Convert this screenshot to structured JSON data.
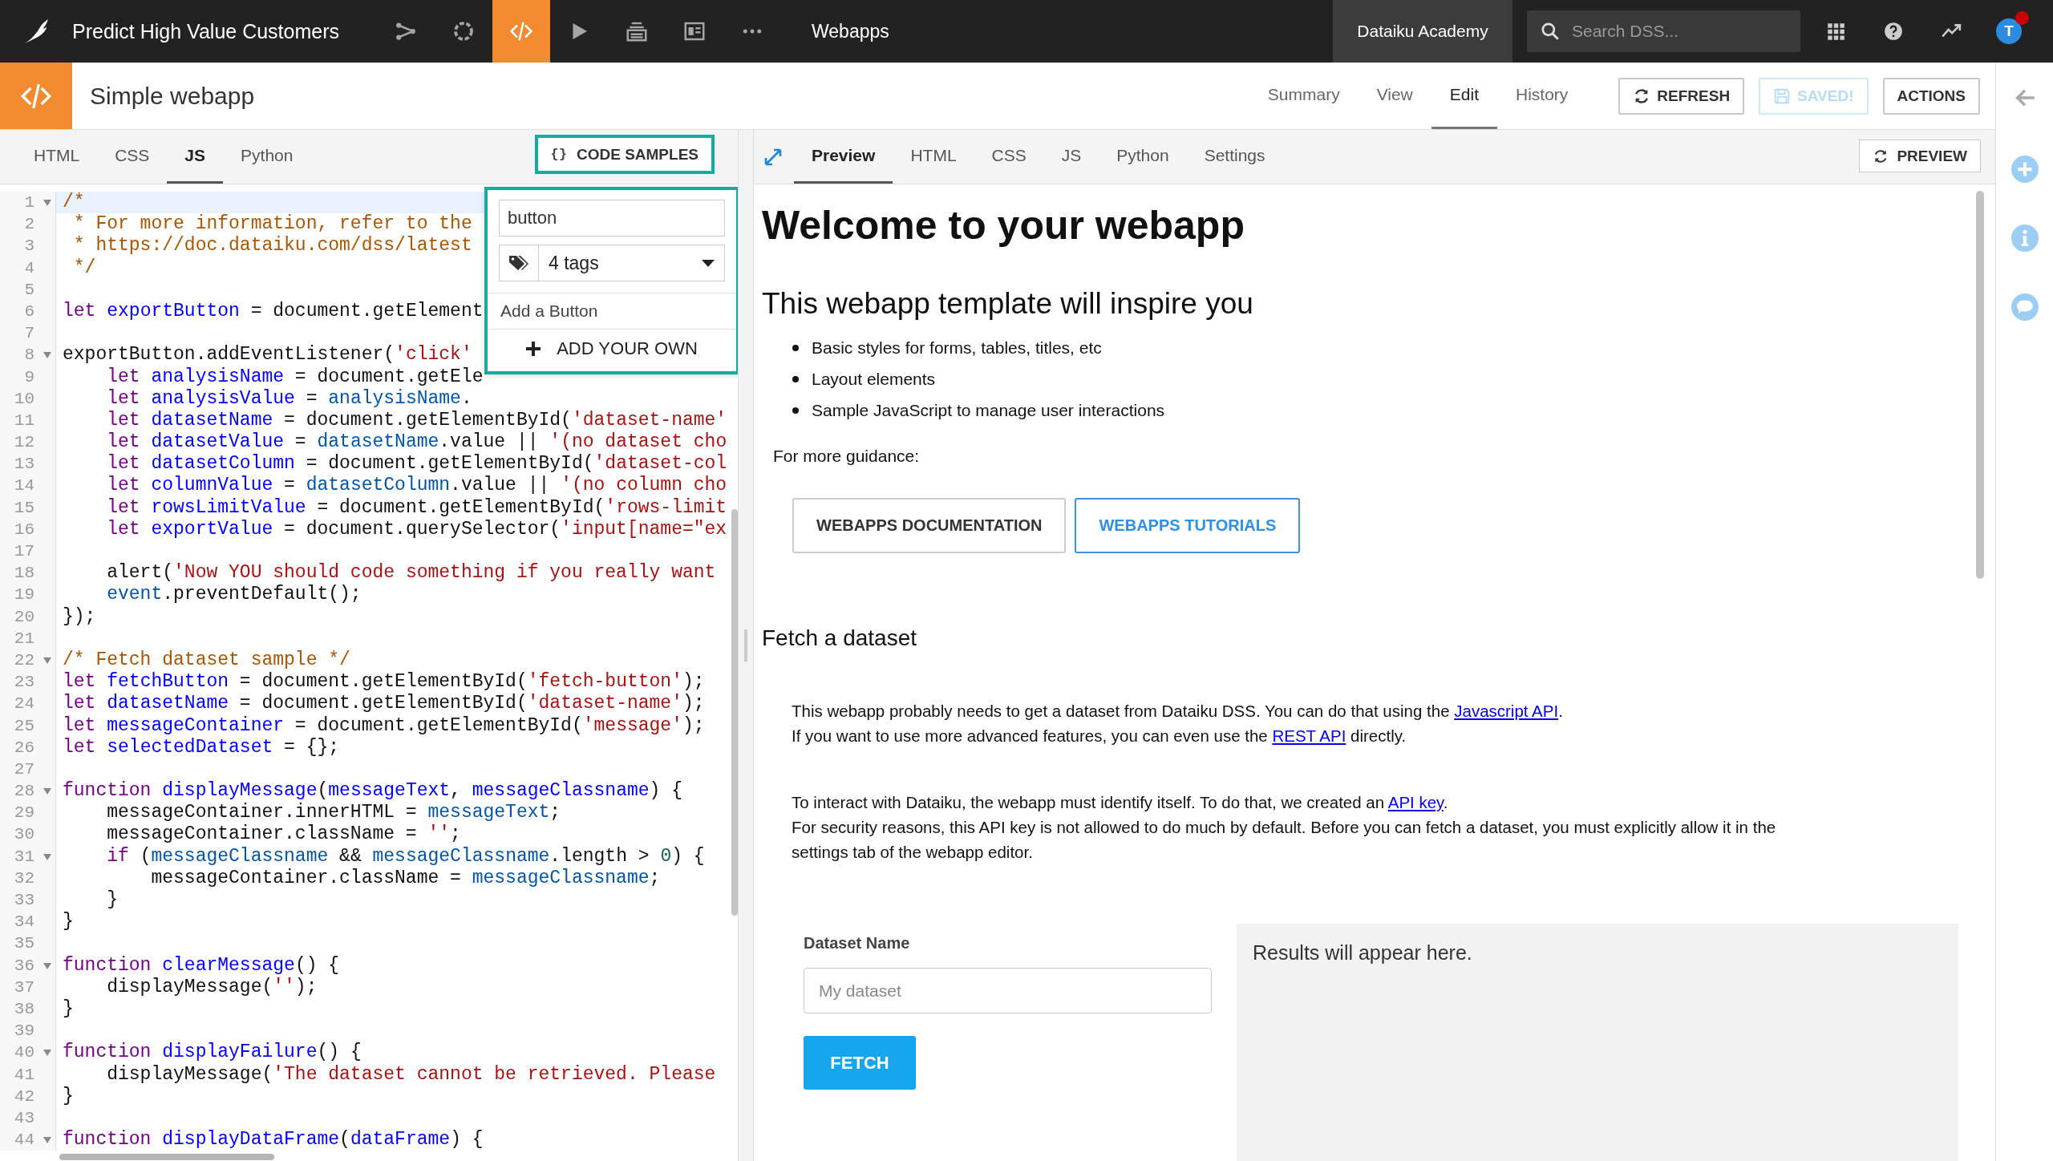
{
  "top_bar": {
    "project_title": "Predict High Value Customers",
    "nav_icons": [
      {
        "kind": "flow",
        "selected": false
      },
      {
        "kind": "lab",
        "selected": false
      },
      {
        "kind": "code",
        "selected": true
      },
      {
        "kind": "run",
        "selected": false
      },
      {
        "kind": "deploy",
        "selected": false
      },
      {
        "kind": "dashboard",
        "selected": false
      },
      {
        "kind": "more",
        "selected": false
      }
    ],
    "section": "Webapps",
    "workspace": "Dataiku Academy",
    "search": {
      "placeholder": "Search DSS..."
    },
    "tools": [
      {
        "kind": "apps"
      },
      {
        "kind": "help"
      },
      {
        "kind": "trend"
      }
    ],
    "avatar": {
      "initial": "T",
      "notification": true
    }
  },
  "header": {
    "title": "Simple webapp",
    "tabs": [
      {
        "label": "Summary",
        "selected": false
      },
      {
        "label": "View",
        "selected": false
      },
      {
        "label": "Edit",
        "selected": true
      },
      {
        "label": "History",
        "selected": false
      }
    ],
    "buttons": [
      {
        "label": "REFRESH",
        "kind": "refresh",
        "disabled": false
      },
      {
        "label": "SAVED!",
        "kind": "save",
        "disabled": true
      },
      {
        "label": "ACTIONS",
        "kind": "plain",
        "disabled": false
      }
    ]
  },
  "editor": {
    "tabs": [
      {
        "label": "HTML",
        "selected": false
      },
      {
        "label": "CSS",
        "selected": false
      },
      {
        "label": "JS",
        "selected": true
      },
      {
        "label": "Python",
        "selected": false
      }
    ],
    "code_samples_button": {
      "glyph": "{}",
      "label": "CODE SAMPLES",
      "highlighted": true
    },
    "code_samples_dropdown": {
      "highlighted": true,
      "search_value": "button",
      "tags_filter": "4 tags",
      "items": [
        "Add a Button"
      ],
      "add_own": "ADD YOUR OWN"
    },
    "lines": [
      {
        "n": "1",
        "fold": true,
        "active": true,
        "tokens": [
          {
            "kind": "com",
            "text": "/*"
          }
        ]
      },
      {
        "n": "2",
        "fold": false,
        "active": false,
        "tokens": [
          {
            "kind": "com",
            "text": " * For more information, refer to the"
          }
        ]
      },
      {
        "n": "3",
        "fold": false,
        "active": false,
        "tokens": [
          {
            "kind": "com",
            "text": " * https://doc.dataiku.com/dss/latest"
          }
        ]
      },
      {
        "n": "4",
        "fold": false,
        "active": false,
        "tokens": [
          {
            "kind": "com",
            "text": " */"
          }
        ]
      },
      {
        "n": "5",
        "fold": false,
        "active": false
      },
      {
        "n": "6",
        "fold": false,
        "active": false,
        "tokens": [
          {
            "kind": "kw",
            "text": "let "
          },
          {
            "kind": "def",
            "text": "exportButton"
          },
          {
            "kind": "p",
            "text": " = document.getElement"
          }
        ]
      },
      {
        "n": "7",
        "fold": false,
        "active": false
      },
      {
        "n": "8",
        "fold": true,
        "active": false,
        "tokens": [
          {
            "kind": "p",
            "text": "exportButton.addEventListener("
          },
          {
            "kind": "str",
            "text": "'click'"
          }
        ]
      },
      {
        "n": "9",
        "fold": false,
        "active": false,
        "tokens": [
          {
            "kind": "kw",
            "text": "    let "
          },
          {
            "kind": "def",
            "text": "analysisName"
          },
          {
            "kind": "p",
            "text": " = document.getEle"
          }
        ]
      },
      {
        "n": "10",
        "fold": false,
        "active": false,
        "tokens": [
          {
            "kind": "kw",
            "text": "    let "
          },
          {
            "kind": "def",
            "text": "analysisValue"
          },
          {
            "kind": "p",
            "text": " = "
          },
          {
            "kind": "var",
            "text": "analysisName"
          },
          {
            "kind": "p",
            "text": "."
          }
        ]
      },
      {
        "n": "11",
        "fold": false,
        "active": false,
        "tokens": [
          {
            "kind": "kw",
            "text": "    let "
          },
          {
            "kind": "def",
            "text": "datasetName"
          },
          {
            "kind": "p",
            "text": " = document.getElementById("
          },
          {
            "kind": "str",
            "text": "'dataset-name'"
          }
        ]
      },
      {
        "n": "12",
        "fold": false,
        "active": false,
        "tokens": [
          {
            "kind": "kw",
            "text": "    let "
          },
          {
            "kind": "def",
            "text": "datasetValue"
          },
          {
            "kind": "p",
            "text": " = "
          },
          {
            "kind": "var",
            "text": "datasetName"
          },
          {
            "kind": "p",
            "text": ".value || "
          },
          {
            "kind": "str",
            "text": "'(no dataset cho"
          }
        ]
      },
      {
        "n": "13",
        "fold": false,
        "active": false,
        "tokens": [
          {
            "kind": "kw",
            "text": "    let "
          },
          {
            "kind": "def",
            "text": "datasetColumn"
          },
          {
            "kind": "p",
            "text": " = document.getElementById("
          },
          {
            "kind": "str",
            "text": "'dataset-col"
          }
        ]
      },
      {
        "n": "14",
        "fold": false,
        "active": false,
        "tokens": [
          {
            "kind": "kw",
            "text": "    let "
          },
          {
            "kind": "def",
            "text": "columnValue"
          },
          {
            "kind": "p",
            "text": " = "
          },
          {
            "kind": "var",
            "text": "datasetColumn"
          },
          {
            "kind": "p",
            "text": ".value || "
          },
          {
            "kind": "str",
            "text": "'(no column cho"
          }
        ]
      },
      {
        "n": "15",
        "fold": false,
        "active": false,
        "tokens": [
          {
            "kind": "kw",
            "text": "    let "
          },
          {
            "kind": "def",
            "text": "rowsLimitValue"
          },
          {
            "kind": "p",
            "text": " = document.getElementById("
          },
          {
            "kind": "str",
            "text": "'rows-limit"
          }
        ]
      },
      {
        "n": "16",
        "fold": false,
        "active": false,
        "tokens": [
          {
            "kind": "kw",
            "text": "    let "
          },
          {
            "kind": "def",
            "text": "exportValue"
          },
          {
            "kind": "p",
            "text": " = document.querySelector("
          },
          {
            "kind": "str",
            "text": "'input[name=\"ex"
          }
        ]
      },
      {
        "n": "17",
        "fold": false,
        "active": false
      },
      {
        "n": "18",
        "fold": false,
        "active": false,
        "tokens": [
          {
            "kind": "p",
            "text": "    alert("
          },
          {
            "kind": "str",
            "text": "'Now YOU should code something if you really want"
          }
        ]
      },
      {
        "n": "19",
        "fold": false,
        "active": false,
        "tokens": [
          {
            "kind": "var",
            "text": "    event"
          },
          {
            "kind": "p",
            "text": ".preventDefault();"
          }
        ]
      },
      {
        "n": "20",
        "fold": false,
        "active": false,
        "tokens": [
          {
            "kind": "p",
            "text": "});"
          }
        ]
      },
      {
        "n": "21",
        "fold": false,
        "active": false
      },
      {
        "n": "22",
        "fold": true,
        "active": false,
        "tokens": [
          {
            "kind": "com",
            "text": "/* Fetch dataset sample */"
          }
        ]
      },
      {
        "n": "23",
        "fold": false,
        "active": false,
        "tokens": [
          {
            "kind": "kw",
            "text": "let "
          },
          {
            "kind": "def",
            "text": "fetchButton"
          },
          {
            "kind": "p",
            "text": " = document.getElementById("
          },
          {
            "kind": "str",
            "text": "'fetch-button'"
          },
          {
            "kind": "p",
            "text": ");"
          }
        ]
      },
      {
        "n": "24",
        "fold": false,
        "active": false,
        "tokens": [
          {
            "kind": "kw",
            "text": "let "
          },
          {
            "kind": "def",
            "text": "datasetName"
          },
          {
            "kind": "p",
            "text": " = document.getElementById("
          },
          {
            "kind": "str",
            "text": "'dataset-name'"
          },
          {
            "kind": "p",
            "text": ");"
          }
        ]
      },
      {
        "n": "25",
        "fold": false,
        "active": false,
        "tokens": [
          {
            "kind": "kw",
            "text": "let "
          },
          {
            "kind": "def",
            "text": "messageContainer"
          },
          {
            "kind": "p",
            "text": " = document.getElementById("
          },
          {
            "kind": "str",
            "text": "'message'"
          },
          {
            "kind": "p",
            "text": ");"
          }
        ]
      },
      {
        "n": "26",
        "fold": false,
        "active": false,
        "tokens": [
          {
            "kind": "kw",
            "text": "let "
          },
          {
            "kind": "def",
            "text": "selectedDataset"
          },
          {
            "kind": "p",
            "text": " = {};"
          }
        ]
      },
      {
        "n": "27",
        "fold": false,
        "active": false
      },
      {
        "n": "28",
        "fold": true,
        "active": false,
        "tokens": [
          {
            "kind": "kw",
            "text": "function "
          },
          {
            "kind": "def",
            "text": "displayMessage"
          },
          {
            "kind": "p",
            "text": "("
          },
          {
            "kind": "def",
            "text": "messageText"
          },
          {
            "kind": "p",
            "text": ", "
          },
          {
            "kind": "def",
            "text": "messageClassname"
          },
          {
            "kind": "p",
            "text": ") {"
          }
        ]
      },
      {
        "n": "29",
        "fold": false,
        "active": false,
        "tokens": [
          {
            "kind": "p",
            "text": "    messageContainer.innerHTML = "
          },
          {
            "kind": "var",
            "text": "messageText"
          },
          {
            "kind": "p",
            "text": ";"
          }
        ]
      },
      {
        "n": "30",
        "fold": false,
        "active": false,
        "tokens": [
          {
            "kind": "p",
            "text": "    messageContainer.className = "
          },
          {
            "kind": "str",
            "text": "''"
          },
          {
            "kind": "p",
            "text": ";"
          }
        ]
      },
      {
        "n": "31",
        "fold": true,
        "active": false,
        "tokens": [
          {
            "kind": "kw",
            "text": "    if"
          },
          {
            "kind": "p",
            "text": " ("
          },
          {
            "kind": "var",
            "text": "messageClassname"
          },
          {
            "kind": "p",
            "text": " && "
          },
          {
            "kind": "var",
            "text": "messageClassname"
          },
          {
            "kind": "p",
            "text": ".length > "
          },
          {
            "kind": "num",
            "text": "0"
          },
          {
            "kind": "p",
            "text": ") {"
          }
        ]
      },
      {
        "n": "32",
        "fold": false,
        "active": false,
        "tokens": [
          {
            "kind": "p",
            "text": "        messageContainer.className = "
          },
          {
            "kind": "var",
            "text": "messageClassname"
          },
          {
            "kind": "p",
            "text": ";"
          }
        ]
      },
      {
        "n": "33",
        "fold": false,
        "active": false,
        "tokens": [
          {
            "kind": "p",
            "text": "    }"
          }
        ]
      },
      {
        "n": "34",
        "fold": false,
        "active": false,
        "tokens": [
          {
            "kind": "p",
            "text": "}"
          }
        ]
      },
      {
        "n": "35",
        "fold": false,
        "active": false
      },
      {
        "n": "36",
        "fold": true,
        "active": false,
        "tokens": [
          {
            "kind": "kw",
            "text": "function "
          },
          {
            "kind": "def",
            "text": "clearMessage"
          },
          {
            "kind": "p",
            "text": "() {"
          }
        ]
      },
      {
        "n": "37",
        "fold": false,
        "active": false,
        "tokens": [
          {
            "kind": "p",
            "text": "    displayMessage("
          },
          {
            "kind": "str",
            "text": "''"
          },
          {
            "kind": "p",
            "text": ");"
          }
        ]
      },
      {
        "n": "38",
        "fold": false,
        "active": false,
        "tokens": [
          {
            "kind": "p",
            "text": "}"
          }
        ]
      },
      {
        "n": "39",
        "fold": false,
        "active": false
      },
      {
        "n": "40",
        "fold": true,
        "active": false,
        "tokens": [
          {
            "kind": "kw",
            "text": "function "
          },
          {
            "kind": "def",
            "text": "displayFailure"
          },
          {
            "kind": "p",
            "text": "() {"
          }
        ]
      },
      {
        "n": "41",
        "fold": false,
        "active": false,
        "tokens": [
          {
            "kind": "p",
            "text": "    displayMessage("
          },
          {
            "kind": "str",
            "text": "'The dataset cannot be retrieved. Please"
          }
        ]
      },
      {
        "n": "42",
        "fold": false,
        "active": false,
        "tokens": [
          {
            "kind": "p",
            "text": "}"
          }
        ]
      },
      {
        "n": "43",
        "fold": false,
        "active": false
      },
      {
        "n": "44",
        "fold": true,
        "active": false,
        "tokens": [
          {
            "kind": "kw",
            "text": "function "
          },
          {
            "kind": "def",
            "text": "displayDataFrame"
          },
          {
            "kind": "p",
            "text": "("
          },
          {
            "kind": "def",
            "text": "dataFrame"
          },
          {
            "kind": "p",
            "text": ") {"
          }
        ]
      }
    ]
  },
  "preview": {
    "tabs": [
      {
        "label": "Preview",
        "selected": true
      },
      {
        "label": "HTML",
        "selected": false
      },
      {
        "label": "CSS",
        "selected": false
      },
      {
        "label": "JS",
        "selected": false
      },
      {
        "label": "Python",
        "selected": false
      },
      {
        "label": "Settings",
        "selected": false
      }
    ],
    "preview_button": "PREVIEW",
    "heading": "Welcome to your webapp",
    "subheading": "This webapp template will inspire you",
    "bullets": [
      "Basic styles for forms, tables, titles, etc",
      "Layout elements",
      "Sample JavaScript to manage user interactions"
    ],
    "guidance": "For more guidance:",
    "guide_buttons": [
      {
        "label": "WEBAPPS DOCUMENTATION",
        "kind": "default"
      },
      {
        "label": "WEBAPPS TUTORIALS",
        "kind": "primary"
      }
    ],
    "section_title": "Fetch a dataset",
    "paragraphs": [
      [
        [
          {
            "t": "This webapp probably needs to get a dataset from Dataiku DSS. You can do that using the "
          },
          {
            "t": "Javascript API",
            "link": true
          },
          {
            "t": "."
          }
        ],
        [
          {
            "t": "If you want to use more advanced features, you can even use the "
          },
          {
            "t": "REST API",
            "link": true
          },
          {
            "t": " directly."
          }
        ]
      ],
      [
        [
          {
            "t": "To interact with Dataiku, the webapp must identify itself. To do that, we created an "
          },
          {
            "t": "API key",
            "link": true
          },
          {
            "t": "."
          }
        ],
        [
          {
            "t": "For security reasons, this API key is not allowed to do much by default. Before you can fetch a dataset, you must explicitly allow it in the"
          }
        ],
        [
          {
            "t": "settings tab of the webapp editor."
          }
        ]
      ]
    ],
    "form": {
      "label": "Dataset Name",
      "placeholder": "My dataset",
      "button": "FETCH"
    },
    "results": "Results will appear here."
  },
  "right_rail": {
    "icons": [
      {
        "kind": "back"
      },
      {
        "kind": "add"
      },
      {
        "kind": "info"
      },
      {
        "kind": "discussion"
      }
    ]
  }
}
